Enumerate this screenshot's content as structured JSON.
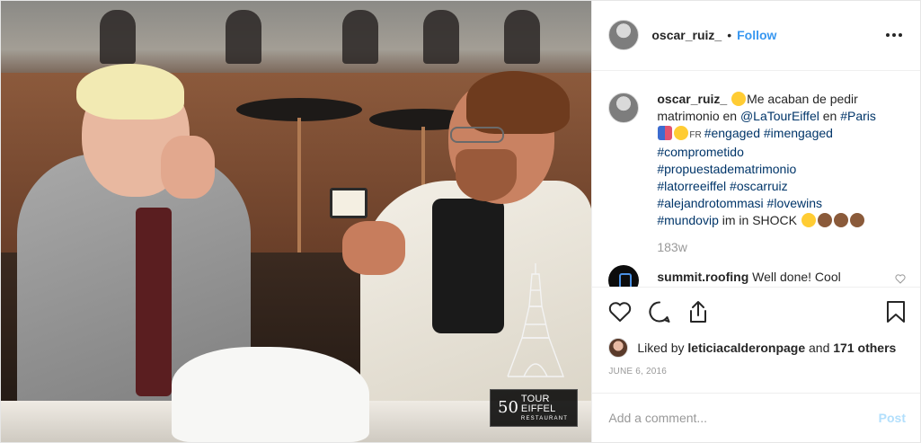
{
  "post": {
    "username": "oscar_ruiz_",
    "follow_label": "Follow",
    "separator": "•"
  },
  "caption": {
    "username": "oscar_ruiz_",
    "text_1": "Me acaban de pedir matrimonio en ",
    "mention": "@LaTourEiffel",
    "text_2": " en ",
    "tag_paris": "#Paris",
    "flag_text": "FR",
    "tags": [
      "#engaged",
      "#imengaged",
      "#comprometido",
      "#propuestadematrimonio",
      "#latorreeiffel",
      "#oscarruiz",
      "#alejandrotommasi",
      "#lovewins",
      "#mundovip"
    ],
    "text_end": " im in SHOCK ",
    "time": "183w"
  },
  "reply": {
    "username": "summit.roofing",
    "text": "Well done! Cool"
  },
  "likes": {
    "prefix": "Liked by ",
    "user": "leticiacalderonpage",
    "and": " and ",
    "others": "171 others"
  },
  "date": "JUNE 6, 2016",
  "add_comment": {
    "placeholder": "Add a comment...",
    "post_label": "Post"
  },
  "photo_logo": {
    "number": "50",
    "name": "TOUR EIFFEL",
    "sub": "RESTAURANT"
  },
  "icons": {
    "like": "heart-icon",
    "comment": "comment-icon",
    "share": "share-icon",
    "save": "bookmark-icon",
    "more": "more-options-icon"
  },
  "colors": {
    "link": "#3897f0",
    "hashtag": "#003569",
    "muted": "#999999",
    "post_disabled": "#b2dffc"
  }
}
